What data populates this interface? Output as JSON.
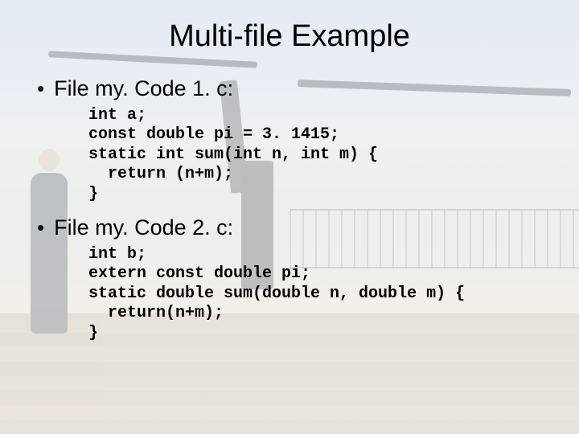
{
  "title": "Multi-file Example",
  "bullets": [
    {
      "label": "File my. Code 1. c:",
      "code": "int a;\nconst double pi = 3. 1415;\nstatic int sum(int n, int m) {\n  return (n+m);\n}"
    },
    {
      "label": "File my. Code 2. c:",
      "code": "int b;\nextern const double pi;\nstatic double sum(double n, double m) {\n  return(n+m);\n}"
    }
  ]
}
